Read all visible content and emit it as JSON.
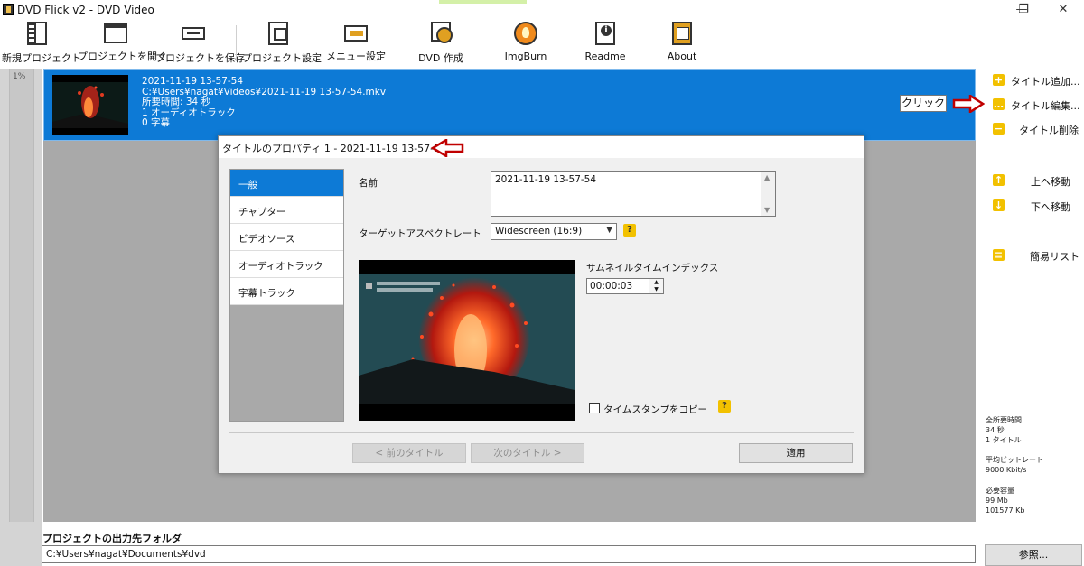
{
  "window": {
    "title": "DVD Flick v2 - DVD Video",
    "minimize": "—",
    "restore": "❐",
    "close": "✕"
  },
  "toolbar": {
    "new_project": "新規プロジェクト",
    "open_project": "プロジェクトを開く",
    "save_project": "プロジェクトを保存",
    "project_settings": "プロジェクト設定",
    "menu_settings": "メニュー設定",
    "create_dvd": "DVD 作成",
    "imgburn": "ImgBurn",
    "readme": "Readme",
    "about": "About"
  },
  "progress_label": "1%",
  "title_row": {
    "name": "2021-11-19 13-57-54",
    "path": "C:¥Users¥nagat¥Videos¥2021-11-19 13-57-54.mkv",
    "duration": "所要時間: 34 秒",
    "audio_tracks": "1 オーディオトラック",
    "subtitles": "0 字幕"
  },
  "right_panel": {
    "add_title": "タイトル追加...",
    "edit_title": "タイトル編集...",
    "delete_title": "タイトル削除",
    "move_up": "上へ移動",
    "move_down": "下へ移動",
    "simple_list": "簡易リスト",
    "stats": {
      "total_time_label": "全所要時間",
      "total_time": "34 秒",
      "title_count": "1 タイトル",
      "avg_bitrate_label": "平均ビットレート",
      "avg_bitrate": "9000 Kbit/s",
      "required_size_label": "必要容量",
      "required_size_mb": "99 Mb",
      "required_size_kb": "101577 Kb"
    }
  },
  "annotation": {
    "click_label": "クリック",
    "accent_color": "#c00000"
  },
  "dialog": {
    "title": "タイトルのプロパティ 1 - 2021-11-19 13-57-54",
    "tabs": [
      "一般",
      "チャプター",
      "ビデオソース",
      "オーディオトラック",
      "字幕トラック"
    ],
    "name_label": "名前",
    "name_value": "2021-11-19 13-57-54",
    "aspect_label": "ターゲットアスペクトレート",
    "aspect_value": "Widescreen (16:9)",
    "thumb_index_label": "サムネイルタイムインデックス",
    "thumb_index_value": "00:00:03",
    "copy_timestamp_label": "タイムスタンプをコピー",
    "help": "?",
    "prev_title": "< 前のタイトル",
    "next_title": "次のタイトル >",
    "apply": "適用"
  },
  "output": {
    "label": "プロジェクトの出力先フォルダ",
    "path": "C:¥Users¥nagat¥Documents¥dvd",
    "browse": "参照..."
  },
  "colors": {
    "selection_blue": "#0d7ad6",
    "list_bg": "#a9a9a9",
    "icon_yellow": "#f2c100"
  }
}
